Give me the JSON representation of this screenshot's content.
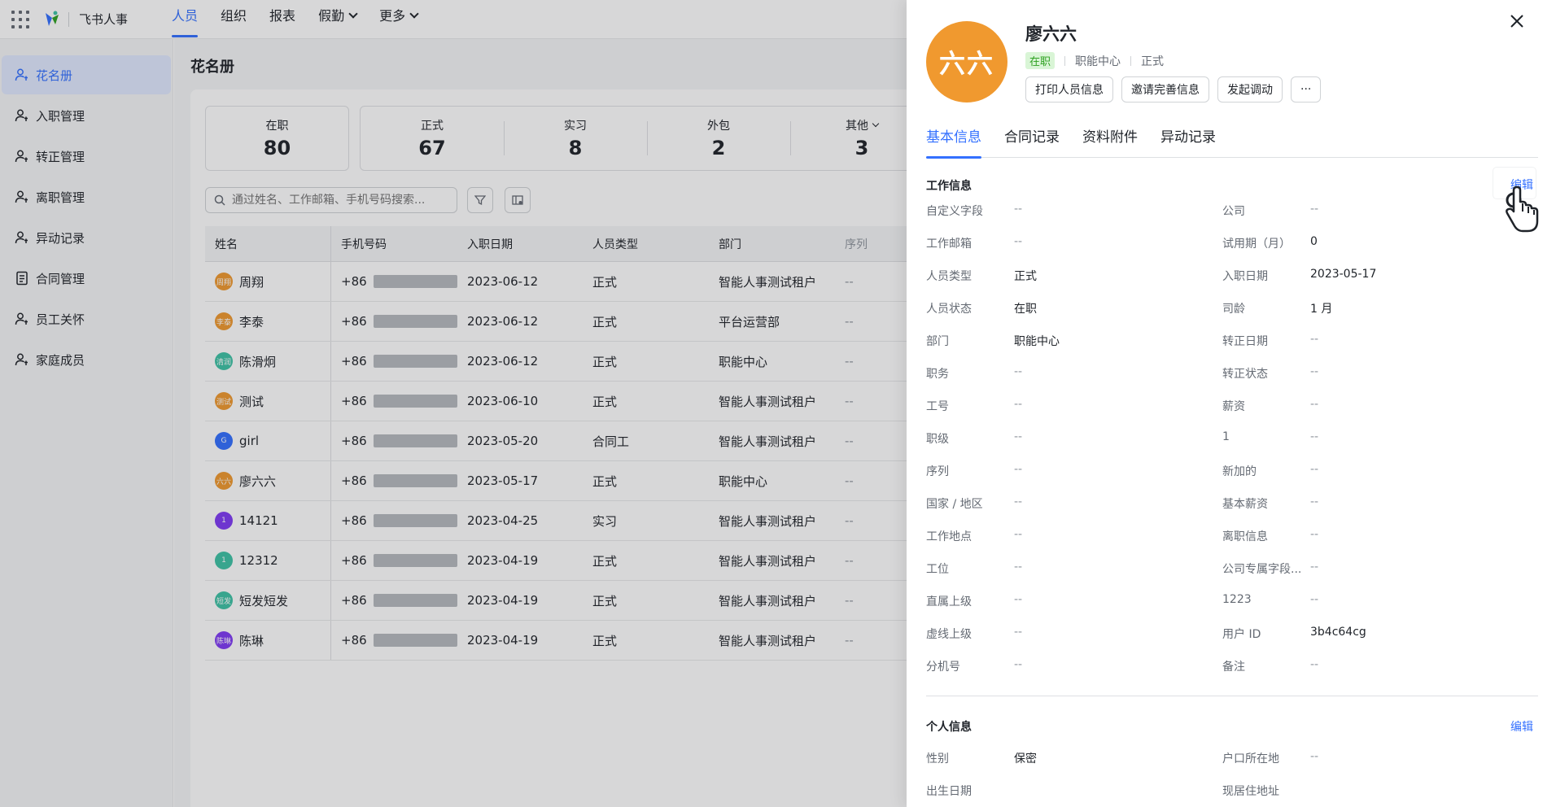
{
  "topnav": {
    "brand": "飞书人事",
    "tabs": [
      {
        "label": "人员",
        "active": true
      },
      {
        "label": "组织"
      },
      {
        "label": "报表"
      },
      {
        "label": "假勤",
        "dropdown": true
      },
      {
        "label": "更多",
        "dropdown": true
      }
    ]
  },
  "sidebar": {
    "items": [
      {
        "label": "花名册",
        "active": true
      },
      {
        "label": "入职管理"
      },
      {
        "label": "转正管理"
      },
      {
        "label": "离职管理"
      },
      {
        "label": "异动记录"
      },
      {
        "label": "合同管理"
      },
      {
        "label": "员工关怀"
      },
      {
        "label": "家庭成员"
      }
    ]
  },
  "main": {
    "title": "花名册",
    "stats": {
      "on_job": {
        "label": "在职",
        "value": "80"
      },
      "group": [
        {
          "label": "正式",
          "value": "67"
        },
        {
          "label": "实习",
          "value": "8"
        },
        {
          "label": "外包",
          "value": "2"
        },
        {
          "label": "其他",
          "value": "3"
        }
      ]
    },
    "search_placeholder": "通过姓名、工作邮箱、手机号码搜索...",
    "table": {
      "headers": [
        "姓名",
        "手机号码",
        "入职日期",
        "人员类型",
        "部门",
        "序列"
      ],
      "rows": [
        {
          "avatar": "周翔",
          "avatar_color": "#f0992f",
          "name": "周翔",
          "phone": "+86",
          "date": "2023-06-12",
          "type": "正式",
          "dept": "智能人事测试租户",
          "seq": "--"
        },
        {
          "avatar": "李泰",
          "avatar_color": "#f0992f",
          "name": "李泰",
          "phone": "+86",
          "date": "2023-06-12",
          "type": "正式",
          "dept": "平台运营部",
          "seq": "--"
        },
        {
          "avatar": "清润",
          "avatar_color": "#3ec3a5",
          "name": "陈滑炯",
          "phone": "+86",
          "date": "2023-06-12",
          "type": "正式",
          "dept": "职能中心",
          "seq": "--"
        },
        {
          "avatar": "测试",
          "avatar_color": "#f0992f",
          "name": "测试",
          "phone": "+86",
          "date": "2023-06-10",
          "type": "正式",
          "dept": "智能人事测试租户",
          "seq": "--"
        },
        {
          "avatar": "G",
          "avatar_color": "#3370ff",
          "name": "girl",
          "phone": "+86",
          "date": "2023-05-20",
          "type": "合同工",
          "dept": "智能人事测试租户",
          "seq": "--"
        },
        {
          "avatar": "六六",
          "avatar_color": "#f0992f",
          "name": "廖六六",
          "phone": "+86",
          "date": "2023-05-17",
          "type": "正式",
          "dept": "职能中心",
          "seq": "--"
        },
        {
          "avatar": "1",
          "avatar_color": "#7f3bf5",
          "name": "14121",
          "phone": "+86",
          "date": "2023-04-25",
          "type": "实习",
          "dept": "智能人事测试租户",
          "seq": "--"
        },
        {
          "avatar": "1",
          "avatar_color": "#3ec3a5",
          "name": "12312",
          "phone": "+86",
          "date": "2023-04-19",
          "type": "正式",
          "dept": "智能人事测试租户",
          "seq": "--"
        },
        {
          "avatar": "短发",
          "avatar_color": "#3ec3a5",
          "name": "短发短发",
          "phone": "+86",
          "date": "2023-04-19",
          "type": "正式",
          "dept": "智能人事测试租户",
          "seq": "--"
        },
        {
          "avatar": "陈琳",
          "avatar_color": "#7f3bf5",
          "name": "陈琳",
          "phone": "+86",
          "date": "2023-04-19",
          "type": "正式",
          "dept": "智能人事测试租户",
          "seq": "--"
        }
      ]
    }
  },
  "drawer": {
    "avatar_text": "六六",
    "name": "廖六六",
    "status": "在职",
    "dept": "职能中心",
    "type": "正式",
    "actions": [
      "打印人员信息",
      "邀请完善信息",
      "发起调动",
      "···"
    ],
    "tabs": [
      "基本信息",
      "合同记录",
      "资料附件",
      "异动记录"
    ],
    "work_info": {
      "title": "工作信息",
      "edit": "编辑",
      "rows": [
        {
          "l1": "自定义字段",
          "v1": "--",
          "l2": "公司",
          "v2": "--"
        },
        {
          "l1": "工作邮箱",
          "v1": "--",
          "l2": "试用期（月）",
          "v2": "0"
        },
        {
          "l1": "人员类型",
          "v1": "正式",
          "l2": "入职日期",
          "v2": "2023-05-17"
        },
        {
          "l1": "人员状态",
          "v1": "在职",
          "l2": "司龄",
          "v2": "1 月"
        },
        {
          "l1": "部门",
          "v1": "职能中心",
          "l2": "转正日期",
          "v2": "--"
        },
        {
          "l1": "职务",
          "v1": "--",
          "l2": "转正状态",
          "v2": "--"
        },
        {
          "l1": "工号",
          "v1": "--",
          "l2": "薪资",
          "v2": "--"
        },
        {
          "l1": "职级",
          "v1": "--",
          "l2": "1",
          "v2": "--"
        },
        {
          "l1": "序列",
          "v1": "--",
          "l2": "新加的",
          "v2": "--"
        },
        {
          "l1": "国家 / 地区",
          "v1": "--",
          "l2": "基本薪资",
          "v2": "--"
        },
        {
          "l1": "工作地点",
          "v1": "--",
          "l2": "离职信息",
          "v2": "--"
        },
        {
          "l1": "工位",
          "v1": "--",
          "l2": "公司专属字段...",
          "v2": "--"
        },
        {
          "l1": "直属上级",
          "v1": "--",
          "l2": "1223",
          "v2": "--"
        },
        {
          "l1": "虚线上级",
          "v1": "--",
          "l2": "用户 ID",
          "v2": "3b4c64cg"
        },
        {
          "l1": "分机号",
          "v1": "--",
          "l2": "备注",
          "v2": "--"
        }
      ]
    },
    "personal_info": {
      "title": "个人信息",
      "edit": "编辑",
      "rows": [
        {
          "l1": "性别",
          "v1": "保密",
          "l2": "户口所在地",
          "v2": "--"
        },
        {
          "l1": "出生日期",
          "v1": "",
          "l2": "现居住地址",
          "v2": ""
        }
      ]
    }
  }
}
